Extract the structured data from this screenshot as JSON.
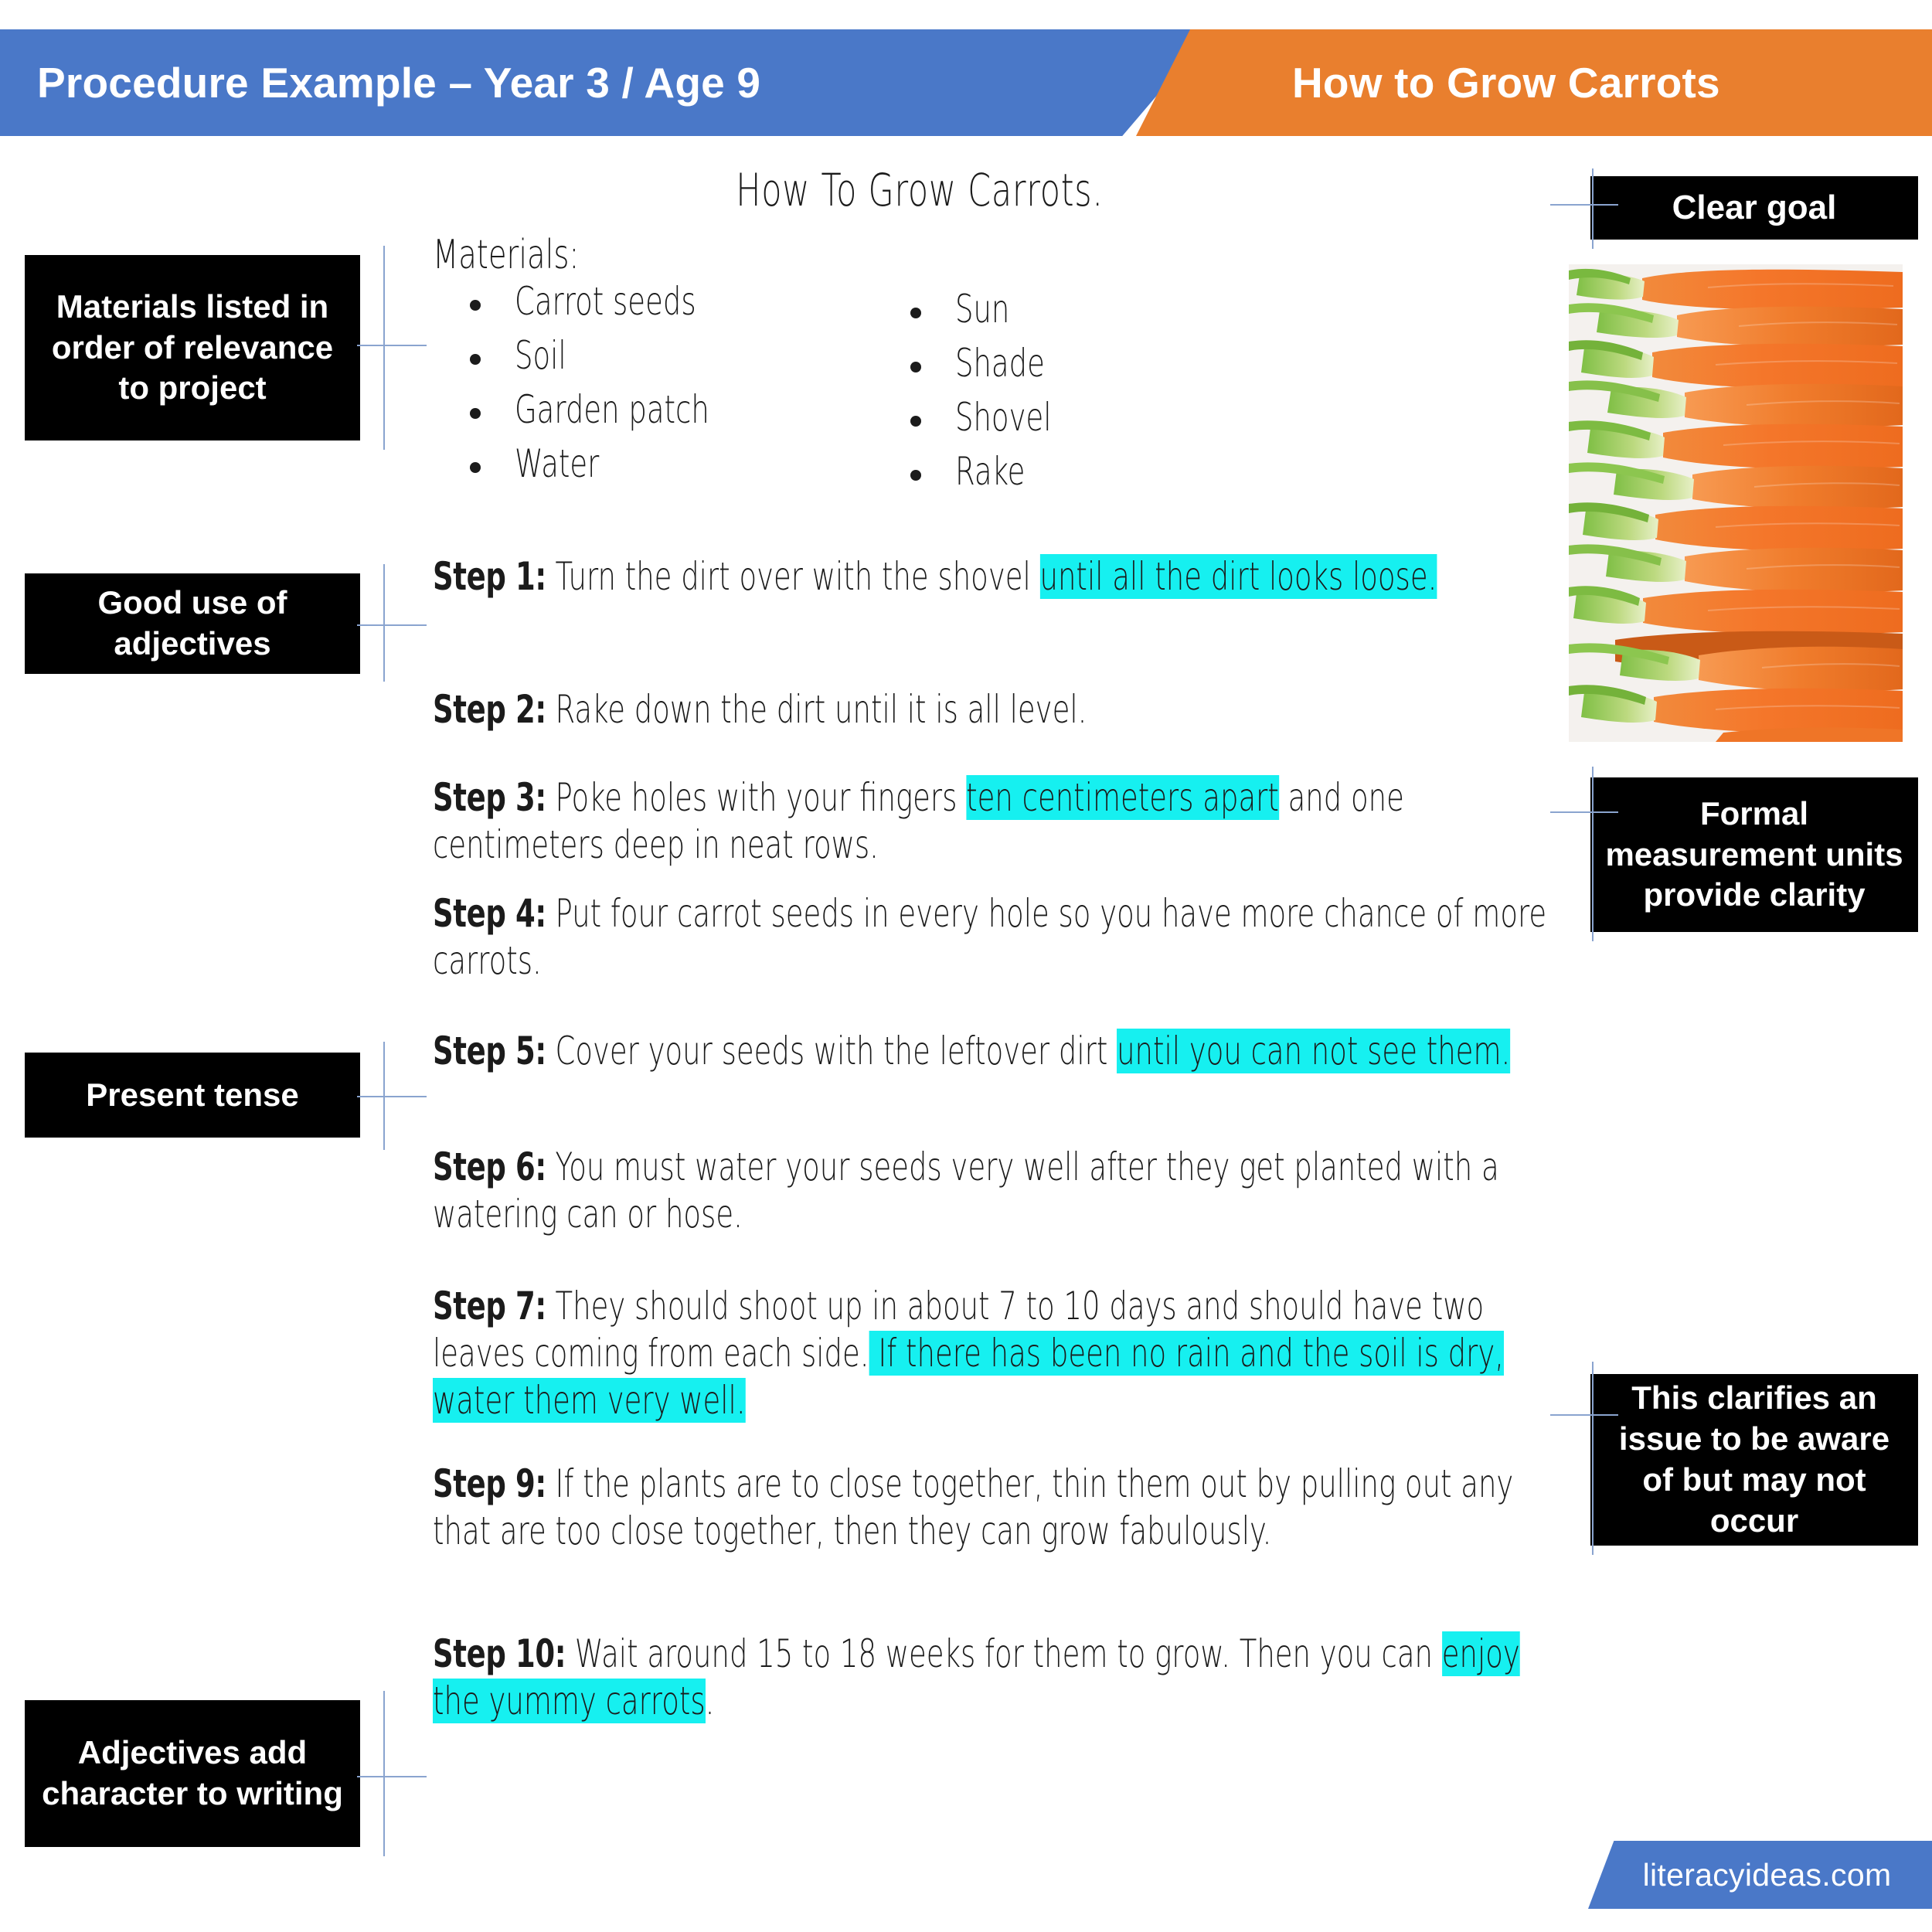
{
  "header": {
    "left_title": "Procedure Example – Year 3 / Age 9",
    "right_title": "How to Grow Carrots",
    "blue": "#4a78c8",
    "orange": "#e97f2e"
  },
  "document": {
    "title": "How To Grow Carrots.",
    "materials_heading": "Materials:",
    "materials_left": [
      "Carrot seeds",
      "Soil",
      "Garden patch",
      "Water"
    ],
    "materials_right": [
      "Sun",
      "Shade",
      "Shovel",
      "Rake"
    ],
    "highlight_color": "#16f0f0",
    "steps": [
      {
        "label": "Step 1:",
        "segments": [
          {
            "text": " Turn the dirt over with the shovel ",
            "highlight": false
          },
          {
            "text": "until all the dirt looks loose.",
            "highlight": true
          }
        ]
      },
      {
        "label": "Step 2:",
        "segments": [
          {
            "text": "  Rake down the dirt until it is all level.",
            "highlight": false
          }
        ]
      },
      {
        "label": "Step 3:",
        "segments": [
          {
            "text": "  Poke holes with your fingers ",
            "highlight": false
          },
          {
            "text": "ten centimeters apart",
            "highlight": true
          },
          {
            "text": " and one centimeters deep in neat rows.",
            "highlight": false
          }
        ]
      },
      {
        "label": "Step 4:",
        "segments": [
          {
            "text": "  Put four carrot seeds in every hole so you have more chance of more carrots.",
            "highlight": false
          }
        ]
      },
      {
        "label": "Step 5:",
        "segments": [
          {
            "text": "  Cover your seeds with the leftover dirt ",
            "highlight": false
          },
          {
            "text": "until you can not see them.",
            "highlight": true
          }
        ]
      },
      {
        "label": "Step 6:",
        "segments": [
          {
            "text": "  You must water your seeds very well after they get planted with a watering can or hose.",
            "highlight": false
          }
        ]
      },
      {
        "label": "Step 7:",
        "segments": [
          {
            "text": "  They should shoot up in about 7 to 10 days and should have two leaves coming from each side.",
            "highlight": false
          },
          {
            "text": "  If there has been no rain and the soil is dry, water them very well.",
            "highlight": true
          }
        ]
      },
      {
        "label": "Step 9:",
        "segments": [
          {
            "text": "  If the plants are to close together, thin them out by pulling out any that are too close together, then they can grow fabulously.",
            "highlight": false
          }
        ]
      },
      {
        "label": "Step 10:",
        "segments": [
          {
            "text": "  Wait around 15 to 18 weeks for them to grow. Then you can ",
            "highlight": false
          },
          {
            "text": "enjoy the yummy carrots",
            "highlight": true
          },
          {
            "text": ".",
            "highlight": false
          }
        ]
      }
    ]
  },
  "annotations": {
    "left": [
      {
        "text": "Materials listed in order of relevance to project"
      },
      {
        "text": "Good use of adjectives"
      },
      {
        "text": "Present tense"
      },
      {
        "text": "Adjectives add character to writing"
      }
    ],
    "right": [
      {
        "text": "Clear goal"
      },
      {
        "text": "Formal measurement units provide clarity"
      },
      {
        "text": "This clarifies an issue to be aware of but may not occur"
      }
    ]
  },
  "image": {
    "alt": "carrots-photo"
  },
  "footer": {
    "logo_text": "literacyideas.com"
  }
}
